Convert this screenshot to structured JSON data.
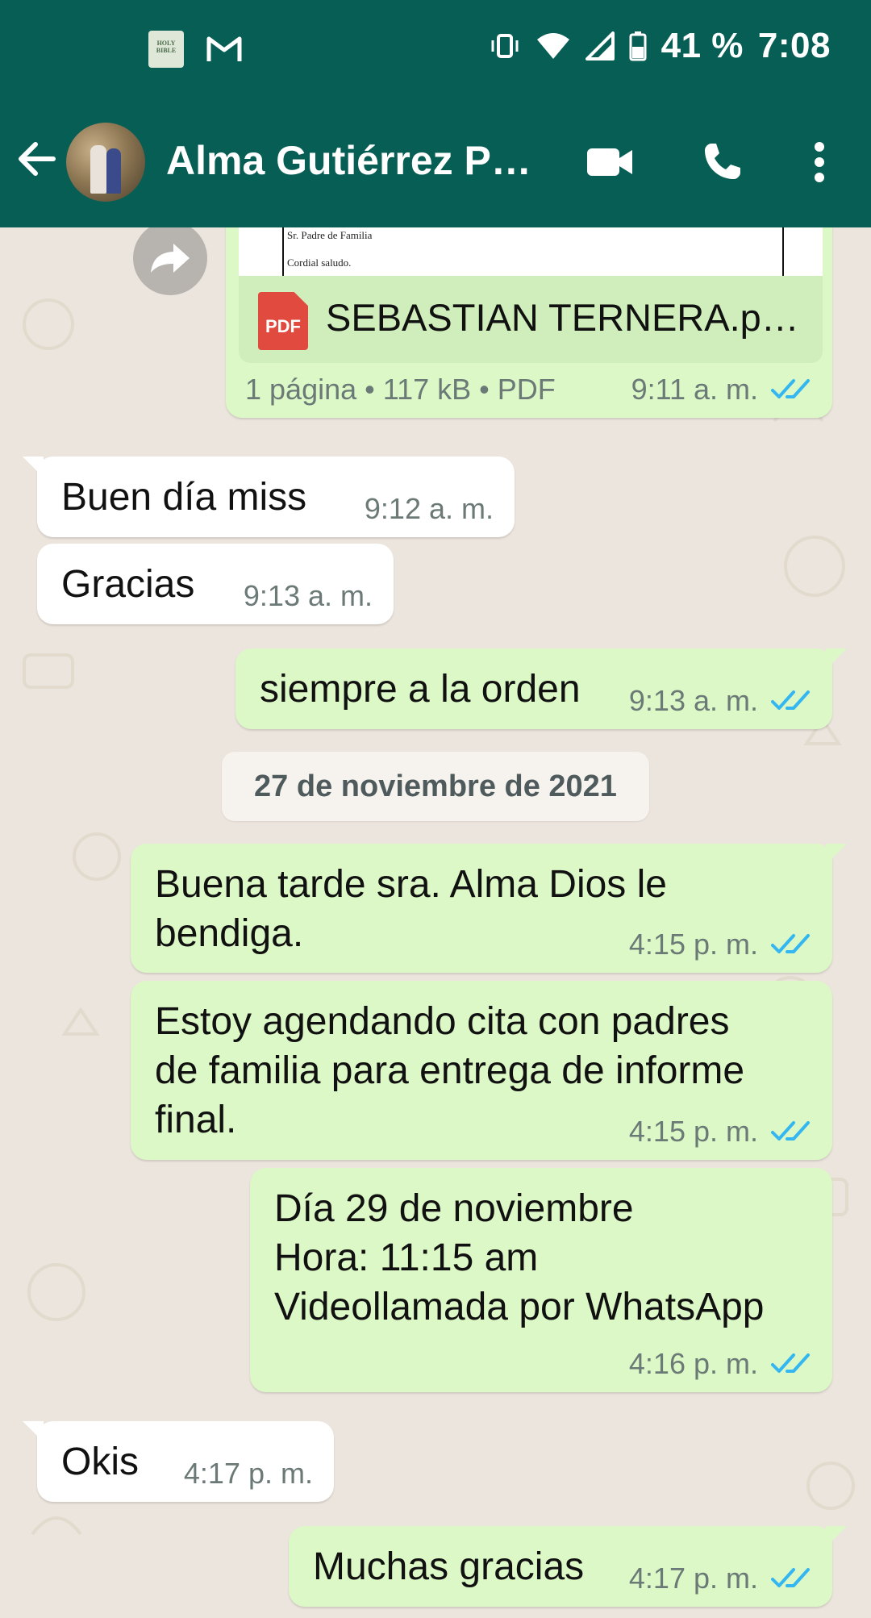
{
  "status_bar": {
    "bible_icon_text": "HOLY BIBLE",
    "battery": "41 %",
    "time": "7:08"
  },
  "header": {
    "contact_name": "Alma Gutiérrez Pa…"
  },
  "document": {
    "preview_line1": "Sr. Padre de Familia",
    "preview_line2": "Cordial saludo.",
    "pdf_label": "PDF",
    "file_name": "SEBASTIAN TERNERA.p…",
    "info": "1 página • 117 kB • PDF",
    "time": "9:11 a. m."
  },
  "messages": [
    {
      "text": "Buen día miss",
      "time": "9:12 a. m."
    },
    {
      "text": "Gracias",
      "time": "9:13 a. m."
    },
    {
      "text": "siempre a la orden",
      "time": "9:13 a. m."
    },
    {
      "text": "Buena tarde sra. Alma Dios le\nbendiga.",
      "time": "4:15 p. m."
    },
    {
      "text": "Estoy agendando cita con padres\nde familia para entrega de informe\nfinal.",
      "time": "4:15 p. m."
    },
    {
      "text": "Día 29 de noviembre\nHora: 11:15 am\nVideollamada por WhatsApp",
      "time": "4:16 p. m."
    },
    {
      "text": "Okis",
      "time": "4:17 p. m."
    },
    {
      "text": "Muchas gracias",
      "time": "4:17 p. m."
    }
  ],
  "date_chip": "27 de noviembre de 2021",
  "colors": {
    "header": "#075e54",
    "outgoing": "#dcf8c6",
    "incoming": "#ffffff",
    "wallpaper": "#ece5dd",
    "read_ticks": "#34b7f1"
  }
}
